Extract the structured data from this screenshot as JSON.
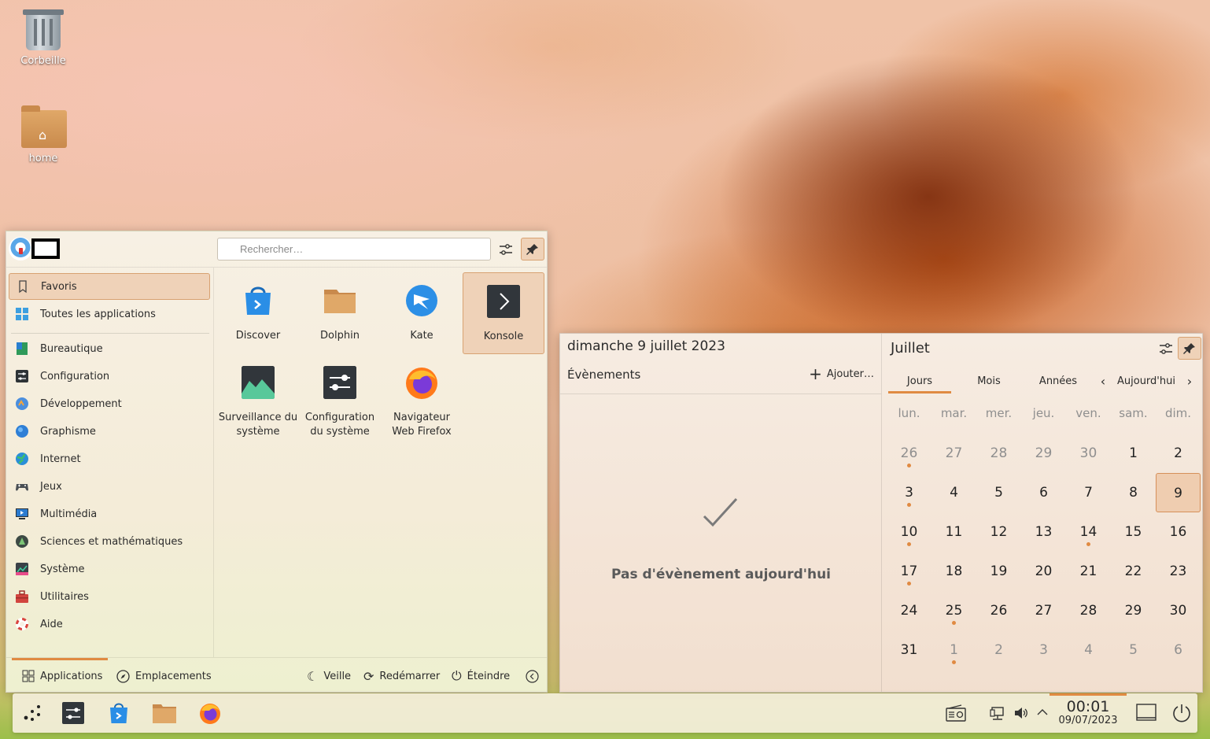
{
  "desktop": {
    "icons": [
      {
        "label": "Corbeille",
        "icon": "trash-icon"
      },
      {
        "label": "home",
        "icon": "home-folder-icon"
      }
    ]
  },
  "launcher": {
    "search": {
      "placeholder": "Rechercher…",
      "value": ""
    },
    "sidebar": [
      {
        "label": "Favoris",
        "icon": "bookmark-icon",
        "active": true
      },
      {
        "label": "Toutes les applications",
        "icon": "grid-icon"
      },
      {
        "label": "Bureautique",
        "icon": "office-icon"
      },
      {
        "label": "Configuration",
        "icon": "settings-icon"
      },
      {
        "label": "Développement",
        "icon": "development-icon"
      },
      {
        "label": "Graphisme",
        "icon": "graphics-icon"
      },
      {
        "label": "Internet",
        "icon": "internet-icon"
      },
      {
        "label": "Jeux",
        "icon": "gamepad-icon"
      },
      {
        "label": "Multimédia",
        "icon": "multimedia-icon"
      },
      {
        "label": "Sciences et mathématiques",
        "icon": "science-icon"
      },
      {
        "label": "Système",
        "icon": "system-icon"
      },
      {
        "label": "Utilitaires",
        "icon": "toolbox-icon"
      },
      {
        "label": "Aide",
        "icon": "help-lifebuoy-icon"
      }
    ],
    "apps": [
      {
        "label": "Discover",
        "icon": "discover-icon"
      },
      {
        "label": "Dolphin",
        "icon": "dolphin-folder-icon"
      },
      {
        "label": "Kate",
        "icon": "kate-icon"
      },
      {
        "label": "Konsole",
        "icon": "konsole-icon",
        "active": true
      },
      {
        "label": "Surveillance du système",
        "icon": "system-monitor-icon"
      },
      {
        "label": "Configuration du système",
        "icon": "system-settings-icon"
      },
      {
        "label": "Navigateur Web Firefox",
        "icon": "firefox-icon"
      }
    ],
    "footer": {
      "tabs": [
        {
          "label": "Applications",
          "icon": "grid-icon",
          "active": true
        },
        {
          "label": "Emplacements",
          "icon": "compass-icon"
        }
      ],
      "actions": [
        {
          "label": "Veille",
          "icon": "sleep-icon"
        },
        {
          "label": "Redémarrer",
          "icon": "restart-icon"
        },
        {
          "label": "Éteindre",
          "icon": "power-icon"
        }
      ]
    }
  },
  "calendar": {
    "date_title": "dimanche 9 juillet 2023",
    "events_label": "Évènements",
    "add_label": "Ajouter…",
    "no_event": "Pas d'évènement aujourd'hui",
    "month": "Juillet",
    "tabs": [
      "Jours",
      "Mois",
      "Années"
    ],
    "today_label": "Aujourd'hui",
    "weekdays": [
      "lun.",
      "mar.",
      "mer.",
      "jeu.",
      "ven.",
      "sam.",
      "dim."
    ],
    "weeks": [
      [
        {
          "d": "26",
          "m": true,
          "e": true
        },
        {
          "d": "27",
          "m": true
        },
        {
          "d": "28",
          "m": true
        },
        {
          "d": "29",
          "m": true
        },
        {
          "d": "30",
          "m": true
        },
        {
          "d": "1"
        },
        {
          "d": "2"
        }
      ],
      [
        {
          "d": "3",
          "e": true
        },
        {
          "d": "4"
        },
        {
          "d": "5"
        },
        {
          "d": "6"
        },
        {
          "d": "7"
        },
        {
          "d": "8"
        },
        {
          "d": "9",
          "t": true
        }
      ],
      [
        {
          "d": "10",
          "e": true
        },
        {
          "d": "11"
        },
        {
          "d": "12"
        },
        {
          "d": "13"
        },
        {
          "d": "14",
          "e": true
        },
        {
          "d": "15"
        },
        {
          "d": "16"
        }
      ],
      [
        {
          "d": "17",
          "e": true
        },
        {
          "d": "18"
        },
        {
          "d": "19"
        },
        {
          "d": "20"
        },
        {
          "d": "21"
        },
        {
          "d": "22"
        },
        {
          "d": "23"
        }
      ],
      [
        {
          "d": "24"
        },
        {
          "d": "25",
          "e": true
        },
        {
          "d": "26"
        },
        {
          "d": "27"
        },
        {
          "d": "28"
        },
        {
          "d": "29"
        },
        {
          "d": "30"
        }
      ],
      [
        {
          "d": "31"
        },
        {
          "d": "1",
          "m": true,
          "e": true
        },
        {
          "d": "2",
          "m": true
        },
        {
          "d": "3",
          "m": true
        },
        {
          "d": "4",
          "m": true
        },
        {
          "d": "5",
          "m": true
        },
        {
          "d": "6",
          "m": true
        }
      ]
    ]
  },
  "taskbar": {
    "apps": [
      "application-launcher-icon",
      "system-settings-icon",
      "discover-icon",
      "dolphin-folder-icon",
      "firefox-icon"
    ],
    "tray": [
      "media-player-icon",
      "network-icon",
      "volume-icon",
      "expand-tray-icon"
    ],
    "clock": {
      "time": "00:01",
      "date": "09/07/2023"
    }
  },
  "colors": {
    "accent": "#e08a42",
    "selection": "#efd2b8"
  }
}
